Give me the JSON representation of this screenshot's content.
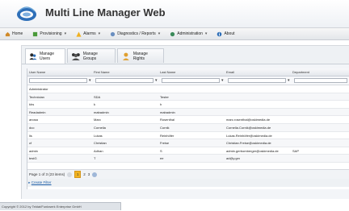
{
  "app": {
    "title": "Multi Line Manager Web"
  },
  "menu": {
    "home": "Home",
    "provisioning": "Provisioning",
    "alarms": "Alarms",
    "diagnostics": "Diagnostics / Reports",
    "administration": "Administration",
    "about": "About"
  },
  "tabs": {
    "manage_users": "Manage Users",
    "manage_groups": "Manage Groups",
    "manage_rights": "Manage Rights"
  },
  "grid": {
    "columns": [
      "User Name",
      "First Name",
      "Last Name",
      "Email",
      "Department"
    ],
    "rows": [
      [
        "Administrator",
        "",
        "",
        "",
        ""
      ],
      [
        "Technician",
        "SDA",
        "Tester",
        "",
        ""
      ],
      [
        "khs",
        "k",
        "h",
        "",
        ""
      ],
      [
        "Readadmin",
        "mabadmin",
        "mabadmin",
        "",
        ""
      ],
      [
        "anosa",
        "Marc",
        "Rosenthal",
        "marc.rosenthal@oskimedia.de",
        ""
      ],
      [
        "dco",
        "Cornelia",
        "Cornik",
        "Cornelia.Cornik@oskimedia.de",
        ""
      ],
      [
        "lis",
        "Lukas",
        "Reinhöfer",
        "Lukas.Reinhöfer@oskimedia.de",
        ""
      ],
      [
        "cf",
        "Christian",
        "Freise",
        "Christian.Freise@oskimedia.de",
        ""
      ],
      [
        "admin",
        "Adhan",
        "S",
        "admin.gerbomberger@oskimedia.de",
        "SAP"
      ],
      [
        "testG",
        "T",
        "ee",
        "ad@y.gm",
        ""
      ]
    ]
  },
  "pager": {
    "text": "Page 1 of 3 (23 items)",
    "current": "1",
    "pages": [
      "2",
      "3"
    ]
  },
  "filter": {
    "label": "Create Filter"
  },
  "status": {
    "text": "Copyright © 2012 by Teldat/Funkwerk Enterprise GmbH"
  },
  "colors": {
    "accent": "#1f5fa8",
    "pager_current": "#f2b422",
    "header_bg": "#eef1f5"
  }
}
